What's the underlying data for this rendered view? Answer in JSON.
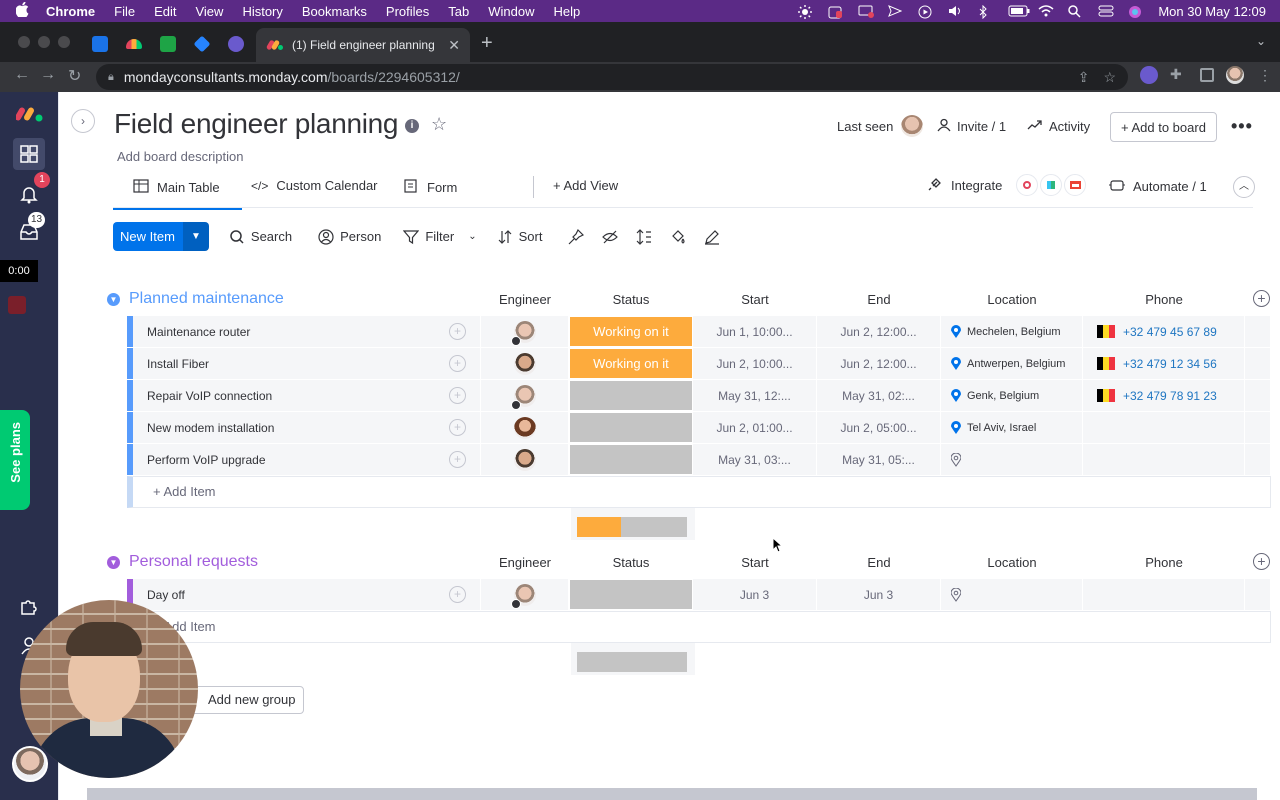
{
  "macos_menubar": {
    "app": "Chrome",
    "items": [
      "File",
      "Edit",
      "View",
      "History",
      "Bookmarks",
      "Profiles",
      "Tab",
      "Window",
      "Help"
    ],
    "clock": "Mon 30 May  12:09"
  },
  "browser": {
    "active_tab_title": "(1) Field engineer planning",
    "url_host": "mondayconsultants.monday.com",
    "url_path": "/boards/2294605312/"
  },
  "rail": {
    "notifications_badge": "1",
    "inbox_badge": "13",
    "timer": "0:00",
    "see_plans": "See plans"
  },
  "board": {
    "title": "Field engineer planning",
    "info_glyph": "i",
    "description": "Add board description",
    "last_seen_label": "Last seen",
    "invite_label": "Invite / 1",
    "activity_label": "Activity",
    "add_to_board_label": "+ Add to board",
    "views": {
      "main_table": "Main Table",
      "custom_calendar": "Custom Calendar",
      "form": "Form",
      "add_view": "+ Add View",
      "integrate": "Integrate",
      "automate": "Automate / 1"
    },
    "toolbar": {
      "new_item": "New Item",
      "search": "Search",
      "person": "Person",
      "filter": "Filter",
      "sort": "Sort"
    }
  },
  "columns": [
    "Engineer",
    "Status",
    "Start",
    "End",
    "Location",
    "Phone"
  ],
  "groups": [
    {
      "title": "Planned maintenance",
      "color": "#579bfc",
      "add_item_label": "+ Add Item",
      "rows": [
        {
          "name": "Maintenance router",
          "status": "Working on it",
          "start": "Jun 1, 10:00...",
          "end": "Jun 2, 12:00...",
          "location": "Mechelen, Belgium",
          "phone": "+32 479 45 67 89"
        },
        {
          "name": "Install Fiber",
          "status": "Working on it",
          "start": "Jun 2, 10:00...",
          "end": "Jun 2, 12:00...",
          "location": "Antwerpen, Belgium",
          "phone": "+32 479 12 34 56"
        },
        {
          "name": "Repair VoIP connection",
          "status": "",
          "start": "May 31, 12:...",
          "end": "May 31, 02:...",
          "location": "Genk, Belgium",
          "phone": "+32 479 78 91 23"
        },
        {
          "name": "New modem installation",
          "status": "",
          "start": "Jun 2, 01:00...",
          "end": "Jun 2, 05:00...",
          "location": "Tel Aviv, Israel",
          "phone": ""
        },
        {
          "name": "Perform VoIP upgrade",
          "status": "",
          "start": "May 31, 03:...",
          "end": "May 31, 05:...",
          "location": "",
          "phone": ""
        }
      ],
      "status_summary": {
        "working_fraction": 0.4
      }
    },
    {
      "title": "Personal requests",
      "color": "#a25ddc",
      "add_item_label": "+ Add Item",
      "rows": [
        {
          "name": "Day off",
          "status": "",
          "start": "Jun 3",
          "end": "Jun 3",
          "location": "",
          "phone": ""
        }
      ],
      "status_summary": {
        "working_fraction": 0
      }
    }
  ],
  "new_group_label": "Add new group",
  "colors": {
    "primary": "#0073ea",
    "working_on_it": "#fdab3d",
    "empty_status": "#c4c4c4",
    "rail_bg": "#292f4c",
    "see_plans_bg": "#00ca72"
  }
}
